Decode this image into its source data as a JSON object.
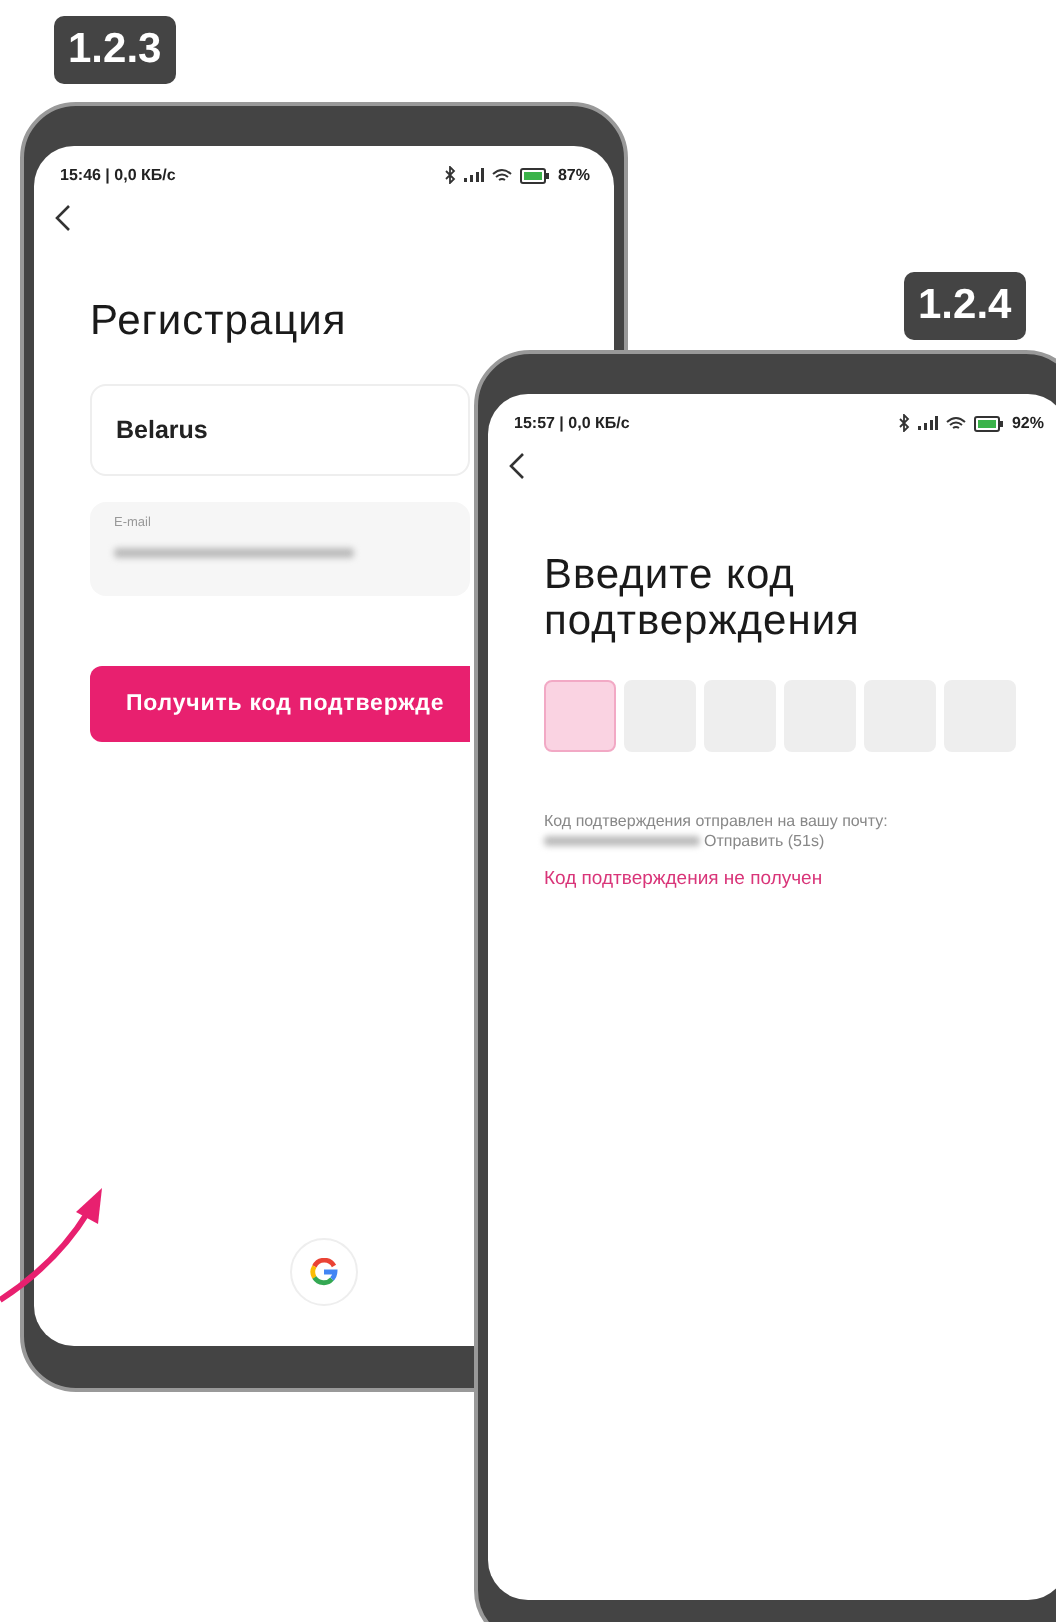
{
  "registration_screen": {
    "badge": "1.2.3",
    "status_bar": {
      "time": "15:46 | 0,0 КБ/с",
      "battery": "87%"
    },
    "title": "Регистрация",
    "country_field": {
      "value": "Belarus"
    },
    "email_field": {
      "label": "E-mail"
    },
    "submit_button": {
      "label": "Получить код подтвержде"
    }
  },
  "verification_screen": {
    "badge": "1.2.4",
    "status_bar": {
      "time": "15:57 | 0,0 КБ/с",
      "battery": "92%"
    },
    "title": "Введите код подтверждения",
    "code_boxes": [
      {
        "selected": true
      },
      {
        "selected": false
      },
      {
        "selected": false
      },
      {
        "selected": false
      },
      {
        "selected": false
      },
      {
        "selected": false
      }
    ],
    "sent_notice": "Код подтверждения отправлен на вашу почту:",
    "resend": "Отправить (51s)",
    "not_received_link": "Код подтверждения не получен"
  }
}
